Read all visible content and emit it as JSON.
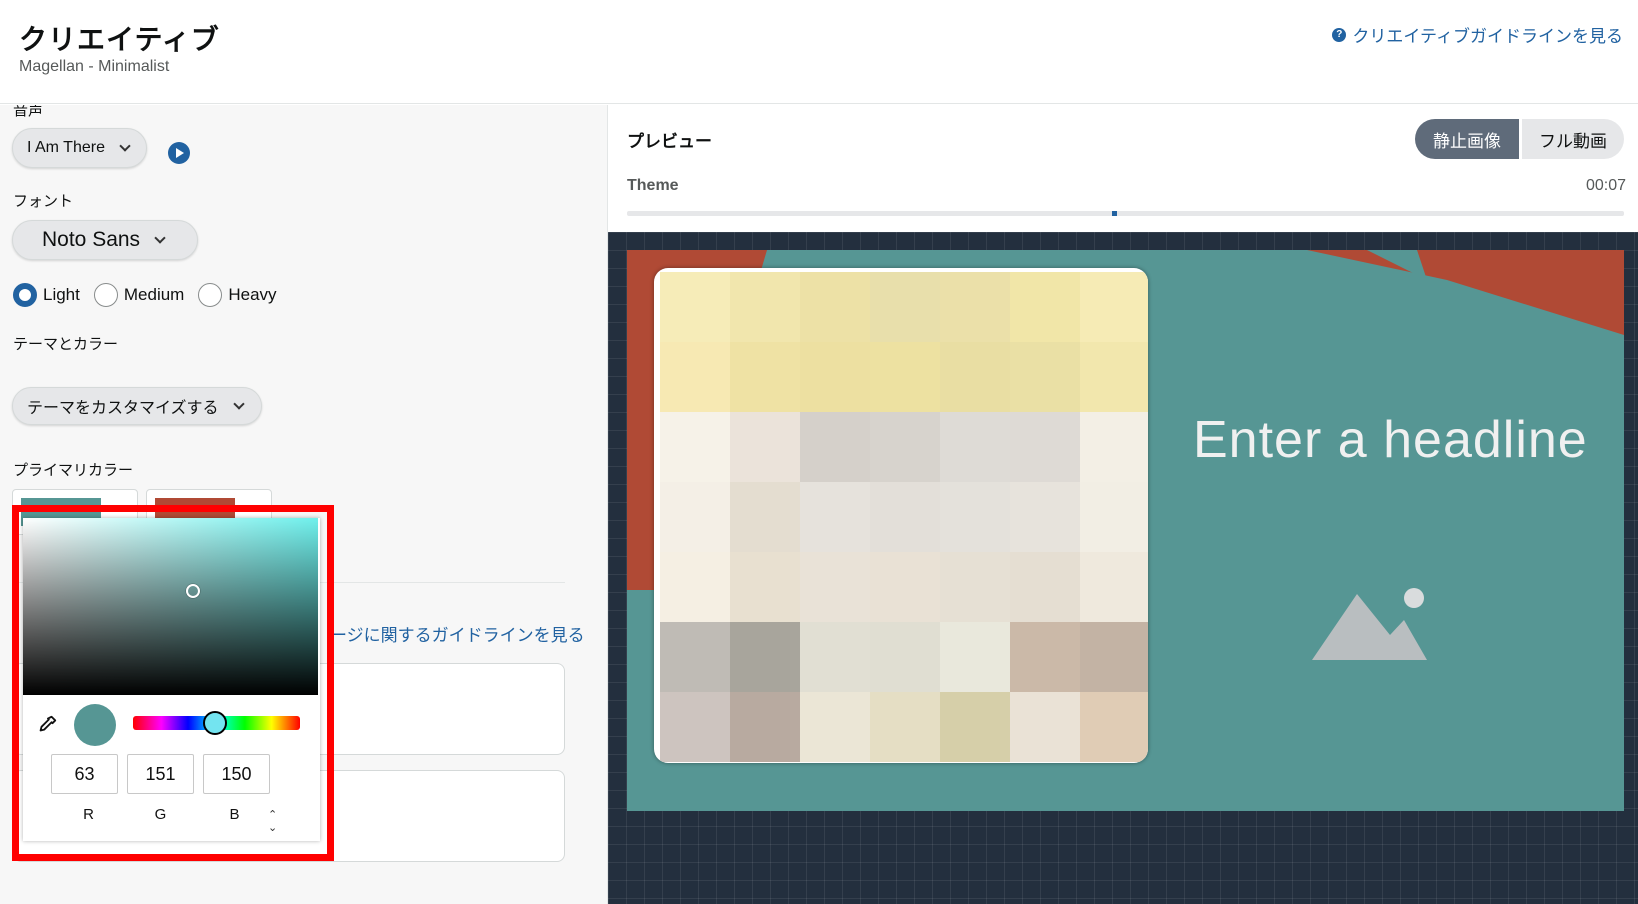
{
  "header": {
    "title": "クリエイティブ",
    "subtitle": "Magellan - Minimalist",
    "guideline_link": "クリエイティブガイドラインを見る",
    "help_icon": "?"
  },
  "left": {
    "audio_label": "音声",
    "audio_value": "I Am There",
    "font_label": "フォント",
    "font_value": "Noto Sans",
    "weights": [
      {
        "label": "Light",
        "selected": true
      },
      {
        "label": "Medium",
        "selected": false
      },
      {
        "label": "Heavy",
        "selected": false
      }
    ],
    "theme_color_label": "テーマとカラー",
    "theme_dropdown": "テーマをカスタマイズする",
    "primary_color_label": "プライマリカラー",
    "swatches": [
      "#569694",
      "#b04a35"
    ],
    "image_guideline_link": "ージに関するガイドラインを見る"
  },
  "picker": {
    "color": "#569694",
    "r": "63",
    "g": "151",
    "b": "150",
    "r_label": "R",
    "g_label": "G",
    "b_label": "B",
    "mode_toggle_icon": "⌃⌄"
  },
  "preview": {
    "title": "プレビュー",
    "tab_still": "静止画像",
    "tab_video": "フル動画",
    "theme_label": "Theme",
    "time": "00:07",
    "headline": "Enter a headline",
    "background_color": "#569694",
    "accent_color": "#b04a35"
  }
}
